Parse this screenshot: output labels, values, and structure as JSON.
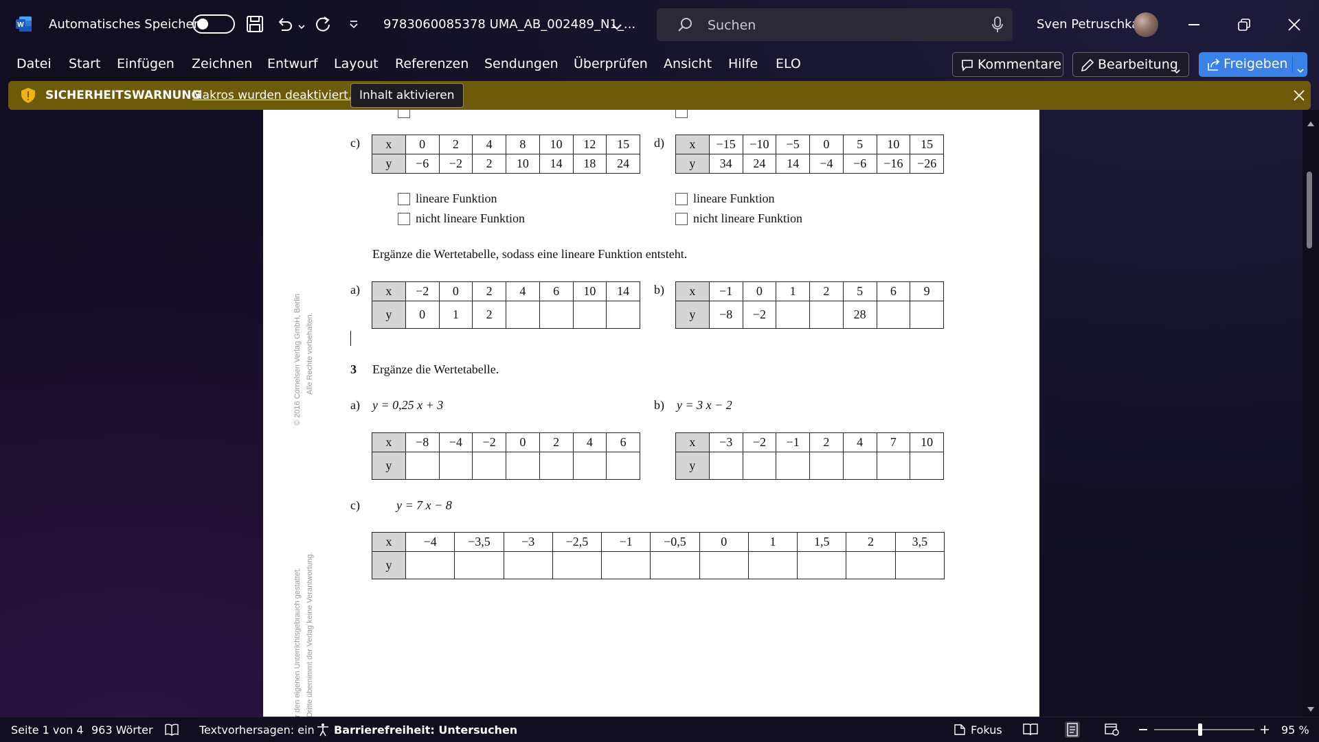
{
  "titlebar": {
    "autosave_label": "Automatisches Speichern",
    "document_title": "9783060085378 UMA_AB_002489_N1_...",
    "search_placeholder": "Suchen",
    "user_name": "Sven Petruschka"
  },
  "menu": {
    "items": [
      "Datei",
      "Start",
      "Einfügen",
      "Zeichnen",
      "Entwurf",
      "Layout",
      "Referenzen",
      "Sendungen",
      "Überprüfen",
      "Ansicht",
      "Hilfe",
      "ELO"
    ],
    "comments_label": "Kommentare",
    "editing_label": "Bearbeitung",
    "share_label": "Freigeben"
  },
  "security": {
    "title": "SICHERHEITSWARNUNG",
    "message": "Makros wurden deaktiviert.",
    "button": "Inhalt aktivieren"
  },
  "doc": {
    "copyright": "© 2016 Cornelsen Verlag GmbH, Berlin",
    "rights": "Alle Rechte vorbehalten.",
    "side_note1": "t für den eigenen Unterrichtsgebrauch gestattet.",
    "side_note2": "ch Dritte übernimmt der Verlag keine Verantwortung.",
    "section1": {
      "c_label": "c)",
      "c_x": [
        "x",
        "0",
        "2",
        "4",
        "8",
        "10",
        "12",
        "15"
      ],
      "c_y": [
        "y",
        "−6",
        "−2",
        "2",
        "10",
        "14",
        "18",
        "24"
      ],
      "d_label": "d)",
      "d_x": [
        "x",
        "−15",
        "−10",
        "−5",
        "0",
        "5",
        "10",
        "15"
      ],
      "d_y": [
        "y",
        "34",
        "24",
        "14",
        "−4",
        "−6",
        "−16",
        "−26"
      ],
      "opt_linear": "lineare Funktion",
      "opt_nonlinear": "nicht lineare Funktion"
    },
    "section2": {
      "instruction": "Ergänze die Wertetabelle, sodass eine lineare Funktion entsteht.",
      "a_label": "a)",
      "a_x": [
        "x",
        "−2",
        "0",
        "2",
        "4",
        "6",
        "10",
        "14"
      ],
      "a_y": [
        "y",
        "0",
        "1",
        "2",
        "",
        "",
        "",
        ""
      ],
      "b_label": "b)",
      "b_x": [
        "x",
        "−1",
        "0",
        "1",
        "2",
        "5",
        "6",
        "9"
      ],
      "b_y": [
        "y",
        "−8",
        "−2",
        "",
        "",
        "28",
        "",
        ""
      ]
    },
    "section3": {
      "number": "3",
      "instruction": "Ergänze die Wertetabelle.",
      "a_label": "a)",
      "a_func": "y = 0,25 x + 3",
      "a_x": [
        "x",
        "−8",
        "−4",
        "−2",
        "0",
        "2",
        "4",
        "6"
      ],
      "a_y": [
        "y",
        "",
        "",
        "",
        "",
        "",
        "",
        ""
      ],
      "b_label": "b)",
      "b_func": "y = 3 x − 2",
      "b_x": [
        "x",
        "−3",
        "−2",
        "−1",
        "2",
        "4",
        "7",
        "10"
      ],
      "b_y": [
        "y",
        "",
        "",
        "",
        "",
        "",
        "",
        ""
      ],
      "c_label": "c)",
      "c_func": "y = 7 x − 8",
      "c_x": [
        "x",
        "−4",
        "−3,5",
        "−3",
        "−2,5",
        "−1",
        "−0,5",
        "0",
        "1",
        "1,5",
        "2",
        "3,5"
      ],
      "c_y": [
        "y",
        "",
        "",
        "",
        "",
        "",
        "",
        "",
        "",
        "",
        "",
        ""
      ]
    }
  },
  "status": {
    "page": "Seite 1 von 4",
    "words": "963 Wörter",
    "predictions": "Textvorhersagen: ein",
    "accessibility": "Barrierefreiheit: Untersuchen",
    "focus": "Fokus",
    "zoom": "95 %"
  }
}
